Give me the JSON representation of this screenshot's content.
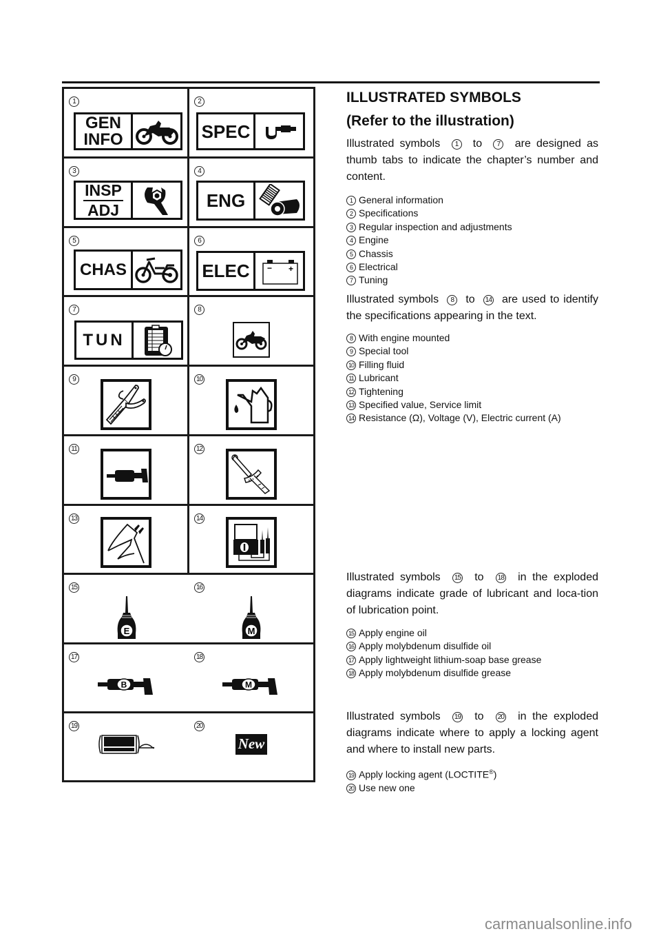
{
  "heading": {
    "title": "ILLUSTRATED SYMBOLS",
    "subtitle": "(Refer to the illustration)"
  },
  "sections": [
    {
      "intro_parts": [
        "Illustrated symbols",
        "1",
        "to",
        "7",
        "are designed as thumb tabs to indicate the chapter’s number and content."
      ],
      "items": [
        {
          "num": "1",
          "label": "General information"
        },
        {
          "num": "2",
          "label": "Specifications"
        },
        {
          "num": "3",
          "label": "Regular inspection and adjustments"
        },
        {
          "num": "4",
          "label": "Engine"
        },
        {
          "num": "5",
          "label": "Chassis"
        },
        {
          "num": "6",
          "label": "Electrical"
        },
        {
          "num": "7",
          "label": "Tuning"
        }
      ]
    },
    {
      "intro_parts": [
        "Illustrated symbols",
        "8",
        "to",
        "14",
        "are used to identify the specifications appearing in the text."
      ],
      "items": [
        {
          "num": "8",
          "label": "With engine mounted"
        },
        {
          "num": "9",
          "label": "Special tool"
        },
        {
          "num": "10",
          "label": "Filling fluid"
        },
        {
          "num": "11",
          "label": "Lubricant"
        },
        {
          "num": "12",
          "label": "Tightening"
        },
        {
          "num": "13",
          "label": "Specified value, Service limit"
        },
        {
          "num": "14",
          "label": "Resistance (Ω), Voltage (V), Electric current (A)"
        }
      ]
    },
    {
      "intro_parts": [
        "Illustrated symbols",
        "15",
        "to",
        "18",
        "in the exploded diagrams indicate grade of lubricant and loca-tion of lubrication point."
      ],
      "items": [
        {
          "num": "15",
          "label": "Apply engine oil"
        },
        {
          "num": "16",
          "label": "Apply molybdenum disulfide oil"
        },
        {
          "num": "17",
          "label": "Apply lightweight lithium-soap base grease"
        },
        {
          "num": "18",
          "label": "Apply molybdenum disulfide grease"
        }
      ]
    },
    {
      "intro_parts": [
        "Illustrated symbols",
        "19",
        "to",
        "20",
        "in the exploded diagrams indicate where to apply a locking agent and where to install new parts."
      ],
      "items": [
        {
          "num": "19",
          "label": "Apply locking agent (LOCTITE",
          "sup": "®",
          "suffix": ")"
        },
        {
          "num": "20",
          "label": "Use new one"
        }
      ]
    }
  ],
  "grid": {
    "cells": [
      {
        "num": "1",
        "tab": [
          "GEN",
          "INFO"
        ],
        "icon": "motorcycle-icon"
      },
      {
        "num": "2",
        "tab": [
          "SPEC"
        ],
        "icon": "micrometer-icon"
      },
      {
        "num": "3",
        "tab": [
          "INSP",
          "ADJ"
        ],
        "icon": "wrench-nut-icon"
      },
      {
        "num": "4",
        "tab": [
          "ENG"
        ],
        "icon": "engine-piston-icon"
      },
      {
        "num": "5",
        "tab": [
          "CHAS"
        ],
        "icon": "chassis-frame-icon"
      },
      {
        "num": "6",
        "tab": [
          "ELEC"
        ],
        "icon": "battery-icon",
        "battery_minus": "−",
        "battery_plus": "+"
      },
      {
        "num": "7",
        "tab": [
          "TUN"
        ],
        "icon": "clipboard-stopwatch-icon"
      },
      {
        "num": "8",
        "icon": "engine-mounted-motorcycle-icon"
      },
      {
        "num": "9",
        "icon": "special-tool-icon"
      },
      {
        "num": "10",
        "icon": "oil-can-icon"
      },
      {
        "num": "11",
        "icon": "lubricant-grease-gun-icon"
      },
      {
        "num": "12",
        "icon": "torque-wrench-icon"
      },
      {
        "num": "13",
        "icon": "caliper-icon"
      },
      {
        "num": "14",
        "icon": "multimeter-icon"
      },
      {
        "num": "15",
        "icon": "oiler-e-icon",
        "letter": "E"
      },
      {
        "num": "16",
        "icon": "oiler-m-icon",
        "letter": "M"
      },
      {
        "num": "17",
        "icon": "grease-b-icon",
        "letter": "B"
      },
      {
        "num": "18",
        "icon": "grease-m-icon",
        "letter": "M"
      },
      {
        "num": "19",
        "icon": "locking-agent-icon"
      },
      {
        "num": "20",
        "icon": "new-part-icon",
        "label": "New"
      }
    ]
  },
  "watermark": "carmanualsonline.info"
}
